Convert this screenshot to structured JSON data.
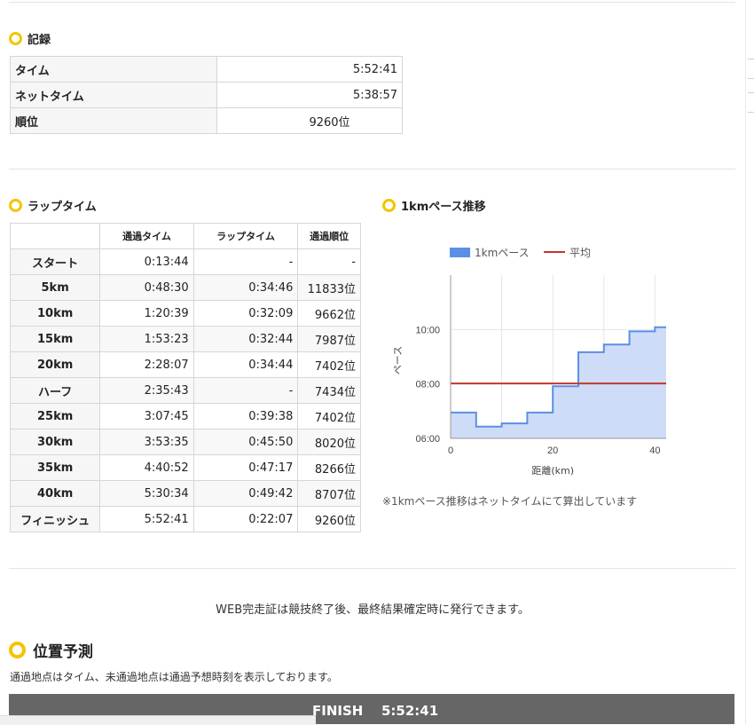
{
  "record": {
    "title": "記録",
    "rows": [
      {
        "label": "タイム",
        "value": "5:52:41"
      },
      {
        "label": "ネットタイム",
        "value": "5:38:57"
      },
      {
        "label": "順位",
        "value": "9260位"
      }
    ]
  },
  "laps": {
    "title": "ラップタイム",
    "headers": [
      "",
      "通過タイム",
      "ラップタイム",
      "通過順位"
    ],
    "rows": [
      {
        "point": "スタート",
        "pass": "0:13:44",
        "lap": "-",
        "rank": "-"
      },
      {
        "point": "5km",
        "pass": "0:48:30",
        "lap": "0:34:46",
        "rank": "11833位"
      },
      {
        "point": "10km",
        "pass": "1:20:39",
        "lap": "0:32:09",
        "rank": "9662位"
      },
      {
        "point": "15km",
        "pass": "1:53:23",
        "lap": "0:32:44",
        "rank": "7987位"
      },
      {
        "point": "20km",
        "pass": "2:28:07",
        "lap": "0:34:44",
        "rank": "7402位"
      },
      {
        "point": "ハーフ",
        "pass": "2:35:43",
        "lap": "-",
        "rank": "7434位"
      },
      {
        "point": "25km",
        "pass": "3:07:45",
        "lap": "0:39:38",
        "rank": "7402位"
      },
      {
        "point": "30km",
        "pass": "3:53:35",
        "lap": "0:45:50",
        "rank": "8020位"
      },
      {
        "point": "35km",
        "pass": "4:40:52",
        "lap": "0:47:17",
        "rank": "8266位"
      },
      {
        "point": "40km",
        "pass": "5:30:34",
        "lap": "0:49:42",
        "rank": "8707位"
      },
      {
        "point": "フィニッシュ",
        "pass": "5:52:41",
        "lap": "0:22:07",
        "rank": "9260位"
      }
    ]
  },
  "pace": {
    "title": "1kmペース推移",
    "note": "※1kmペース推移はネットタイムにて算出しています"
  },
  "chart_data": {
    "type": "area",
    "title": "",
    "xlabel": "距離(km)",
    "ylabel": "ペース",
    "xlim": [
      0,
      42.195
    ],
    "ylim": [
      "06:00",
      "12:00"
    ],
    "x_ticks": [
      "0",
      "20",
      "40"
    ],
    "y_ticks": [
      "06:00",
      "08:00",
      "10:00"
    ],
    "grid": true,
    "legend_position": "top",
    "series": [
      {
        "name": "1kmペース",
        "step": true,
        "color": "#5b8fe6",
        "fill": "#cfdcf7",
        "points": [
          {
            "x": 0,
            "y": "06:57"
          },
          {
            "x": 5,
            "y": "06:26"
          },
          {
            "x": 10,
            "y": "06:33"
          },
          {
            "x": 15,
            "y": "06:57"
          },
          {
            "x": 20,
            "y": "07:55"
          },
          {
            "x": 25,
            "y": "09:10"
          },
          {
            "x": 30,
            "y": "09:27"
          },
          {
            "x": 35,
            "y": "09:56"
          },
          {
            "x": 40,
            "y": "10:05"
          }
        ]
      },
      {
        "name": "平均",
        "color": "#c0392b",
        "value": "08:01"
      }
    ]
  },
  "certificate_message": "WEB完走証は競技終了後、最終結果確定時に発行できます。",
  "position": {
    "title": "位置予測",
    "description": "通過地点はタイム、未通過地点は通過予想時刻を表示しております。",
    "finish_label": "FINISH",
    "finish_time": "5:52:41"
  }
}
